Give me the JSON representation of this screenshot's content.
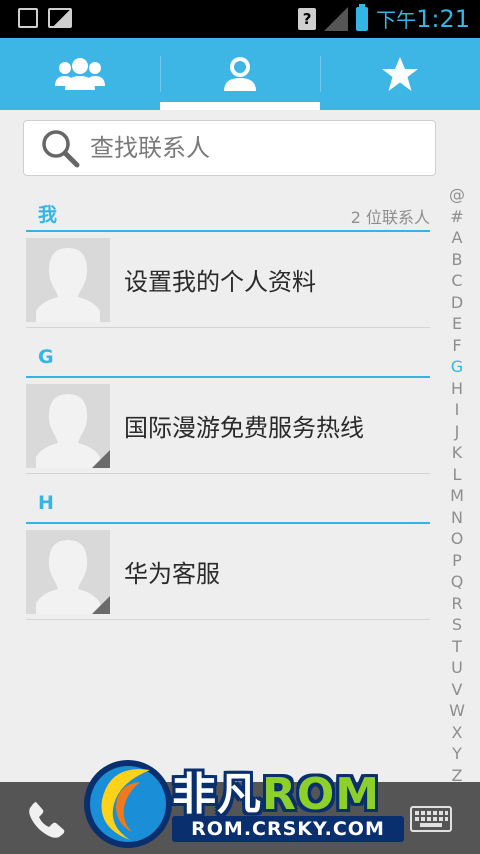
{
  "status_bar": {
    "time_prefix": "下午",
    "time": "1:21",
    "icons": [
      "text-notification-icon",
      "image-notification-icon",
      "unknown-sim-icon",
      "signal-icon",
      "battery-icon"
    ]
  },
  "tabs": [
    {
      "name": "groups",
      "icon": "groups-icon",
      "active": false
    },
    {
      "name": "contacts",
      "icon": "person-icon",
      "active": true
    },
    {
      "name": "favorites",
      "icon": "star-icon",
      "active": false
    }
  ],
  "search": {
    "placeholder": "查找联系人"
  },
  "sections": [
    {
      "letter": "我",
      "count": "2 位联系人",
      "contacts": [
        {
          "name": "设置我的个人资料"
        }
      ]
    },
    {
      "letter": "G",
      "contacts": [
        {
          "name": "国际漫游免费服务热线"
        }
      ]
    },
    {
      "letter": "H",
      "contacts": [
        {
          "name": "华为客服"
        }
      ]
    }
  ],
  "alphabet": [
    "@",
    "#",
    "A",
    "B",
    "C",
    "D",
    "E",
    "F",
    "G",
    "H",
    "I",
    "J",
    "K",
    "L",
    "M",
    "N",
    "O",
    "P",
    "Q",
    "R",
    "S",
    "T",
    "U",
    "V",
    "W",
    "X",
    "Y",
    "Z"
  ],
  "alphabet_highlight": "G",
  "watermark": {
    "title_part1": "非凡",
    "title_part2": "ROM",
    "url": "ROM.CRSKY.COM"
  },
  "colors": {
    "accent": "#33b5e5",
    "tabbar": "#3db6e5",
    "bottombar": "#555555"
  }
}
